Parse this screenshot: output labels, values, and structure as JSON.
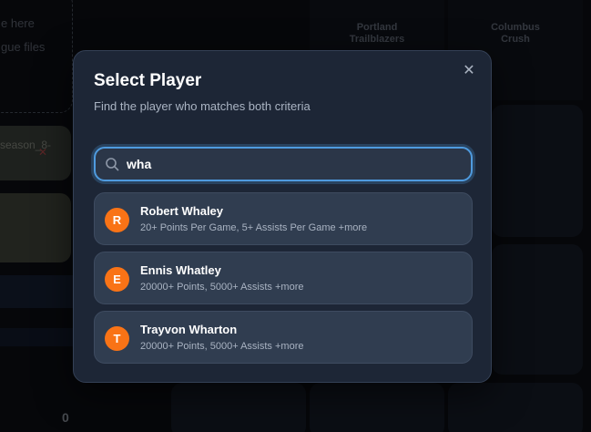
{
  "background": {
    "drop_zone": {
      "line1": "e here",
      "line2": "gue files"
    },
    "file_chip": {
      "label": "season_8-",
      "remove_icon": "x-icon"
    },
    "score": "0",
    "teams": [
      {
        "name": "Portland Trailblazers"
      },
      {
        "name": "Columbus Crush"
      }
    ]
  },
  "modal": {
    "title": "Select Player",
    "subtitle": "Find the player who matches both criteria",
    "close_icon": "close-icon",
    "search": {
      "value": "wha",
      "placeholder": "",
      "icon": "search-icon"
    },
    "results": [
      {
        "initial": "R",
        "name": "Robert Whaley",
        "criteria": "20+ Points Per Game, 5+ Assists Per Game +more"
      },
      {
        "initial": "E",
        "name": "Ennis Whatley",
        "criteria": "20000+ Points, 5000+ Assists +more"
      },
      {
        "initial": "T",
        "name": "Trayvon Wharton",
        "criteria": "20000+ Points, 5000+ Assists +more"
      }
    ]
  },
  "colors": {
    "accent": "#4f9bdf",
    "avatar": "#f97316",
    "modal_bg": "#1d2636",
    "result_bg": "#303d50"
  }
}
